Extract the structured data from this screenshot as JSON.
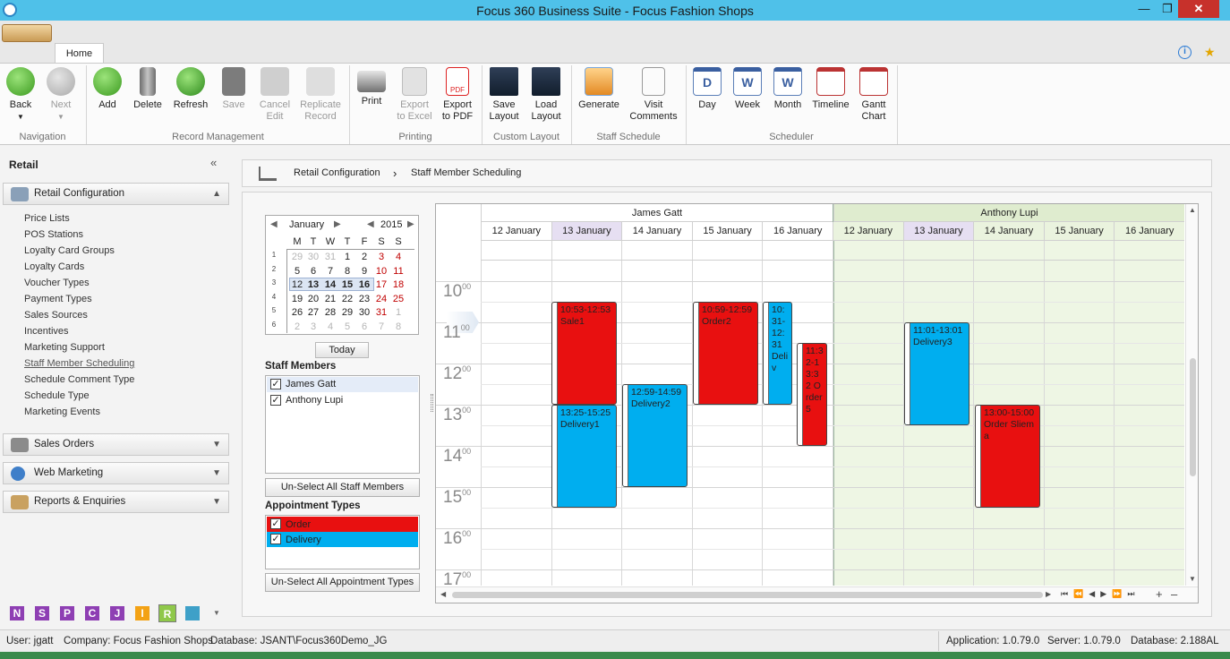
{
  "window": {
    "title": "Focus 360 Business Suite - Focus Fashion Shops"
  },
  "ribbon": {
    "tab": "Home",
    "groups": [
      {
        "label": "Navigation",
        "buttons": [
          {
            "label": "Back",
            "icon": "back-arrow-icon"
          },
          {
            "label": "Next",
            "icon": "next-arrow-icon"
          }
        ]
      },
      {
        "label": "Record Management",
        "buttons": [
          {
            "label": "Add",
            "icon": "add-icon"
          },
          {
            "label": "Delete",
            "icon": "trash-icon"
          },
          {
            "label": "Refresh",
            "icon": "refresh-icon"
          },
          {
            "label": "Save",
            "icon": "save-icon"
          },
          {
            "label": "Cancel\nEdit",
            "icon": "cancel-edit-icon"
          },
          {
            "label": "Replicate\nRecord",
            "icon": "replicate-icon"
          }
        ]
      },
      {
        "label": "Printing",
        "buttons": [
          {
            "label": "Print",
            "icon": "printer-icon"
          },
          {
            "label": "Export\nto Excel",
            "icon": "excel-icon"
          },
          {
            "label": "Export\nto PDF",
            "icon": "pdf-icon"
          }
        ]
      },
      {
        "label": "Custom Layout",
        "buttons": [
          {
            "label": "Save\nLayout",
            "icon": "save-layout-icon"
          },
          {
            "label": "Load\nLayout",
            "icon": "load-layout-icon"
          }
        ]
      },
      {
        "label": "Staff Schedule",
        "buttons": [
          {
            "label": "Generate",
            "icon": "generate-icon"
          },
          {
            "label": "Visit\nComments",
            "icon": "comments-icon"
          }
        ]
      },
      {
        "label": "Scheduler",
        "buttons": [
          {
            "label": "Day",
            "icon": "day-view-icon"
          },
          {
            "label": "Week",
            "icon": "week-view-icon"
          },
          {
            "label": "Month",
            "icon": "month-view-icon"
          },
          {
            "label": "Timeline",
            "icon": "timeline-icon"
          },
          {
            "label": "Gantt\nChart",
            "icon": "gantt-icon"
          }
        ]
      }
    ]
  },
  "sidebar": {
    "title": "Retail",
    "section_open": "Retail Configuration",
    "items": [
      "Price Lists",
      "POS Stations",
      "Loyalty Card Groups",
      "Loyalty Cards",
      "Voucher Types",
      "Payment Types",
      "Sales Sources",
      "Incentives",
      "Marketing Support",
      "Staff Member Scheduling",
      "Schedule Comment Type",
      "Schedule Type",
      "Marketing Events"
    ],
    "sections": [
      "Sales Orders",
      "Web Marketing",
      "Reports & Enquiries"
    ],
    "bottom_icons": [
      "N",
      "S",
      "P",
      "C",
      "J",
      "I",
      "R"
    ]
  },
  "breadcrumb": {
    "root": "Retail Configuration",
    "sep": "›",
    "current": "Staff Member Scheduling"
  },
  "calendar": {
    "month": "January",
    "year": "2015",
    "dow": [
      "M",
      "T",
      "W",
      "T",
      "F",
      "S",
      "S"
    ],
    "weeks": [
      "1",
      "2",
      "3",
      "4",
      "5",
      "6"
    ],
    "days": [
      [
        "29",
        "30",
        "31",
        "1",
        "2",
        "3",
        "4"
      ],
      [
        "5",
        "6",
        "7",
        "8",
        "9",
        "10",
        "11"
      ],
      [
        "12",
        "13",
        "14",
        "15",
        "16",
        "17",
        "18"
      ],
      [
        "19",
        "20",
        "21",
        "22",
        "23",
        "24",
        "25"
      ],
      [
        "26",
        "27",
        "28",
        "29",
        "30",
        "31",
        "1"
      ],
      [
        "2",
        "3",
        "4",
        "5",
        "6",
        "7",
        "8"
      ]
    ],
    "today": "Today"
  },
  "staff": {
    "label": "Staff Members",
    "members": [
      "James Gatt",
      "Anthony Lupi"
    ],
    "unselect": "Un-Select All Staff Members"
  },
  "appt_types": {
    "label": "Appointment Types",
    "types": [
      "Order",
      "Delivery"
    ],
    "unselect": "Un-Select All Appointment Types"
  },
  "scheduler": {
    "resources": [
      "James Gatt",
      "Anthony Lupi"
    ],
    "days": [
      "12 January",
      "13 January",
      "14 January",
      "15 January",
      "16 January"
    ],
    "hours": [
      "10",
      "11",
      "12",
      "13",
      "14",
      "15",
      "16",
      "17"
    ],
    "minutes": "00",
    "appointments": [
      {
        "text": "10:53-12:53 Sale1"
      },
      {
        "text": "13:25-15:25 Delivery1"
      },
      {
        "text": "12:59-14:59 Delivery2"
      },
      {
        "text": "10:59-12:59 Order2"
      },
      {
        "text": "10:31-12:31 Deliv"
      },
      {
        "text": "11:32-13:32 Order5"
      },
      {
        "text": "11:01-13:01 Delivery3"
      },
      {
        "text": "13:00-15:00 Order Sliema"
      }
    ]
  },
  "statusbar": {
    "user": "User: jgatt",
    "company": "Company: Focus Fashion Shops",
    "database": "Database: JSANT\\Focus360Demo_JG",
    "app": "Application: 1.0.79.0",
    "server": "Server: 1.0.79.0",
    "db": "Database: 2.188AL"
  },
  "colors": {
    "order": "#e81010",
    "delivery": "#00aeef",
    "titlebar": "#4fc1e9",
    "lupi_bg": "#eef6e4"
  }
}
